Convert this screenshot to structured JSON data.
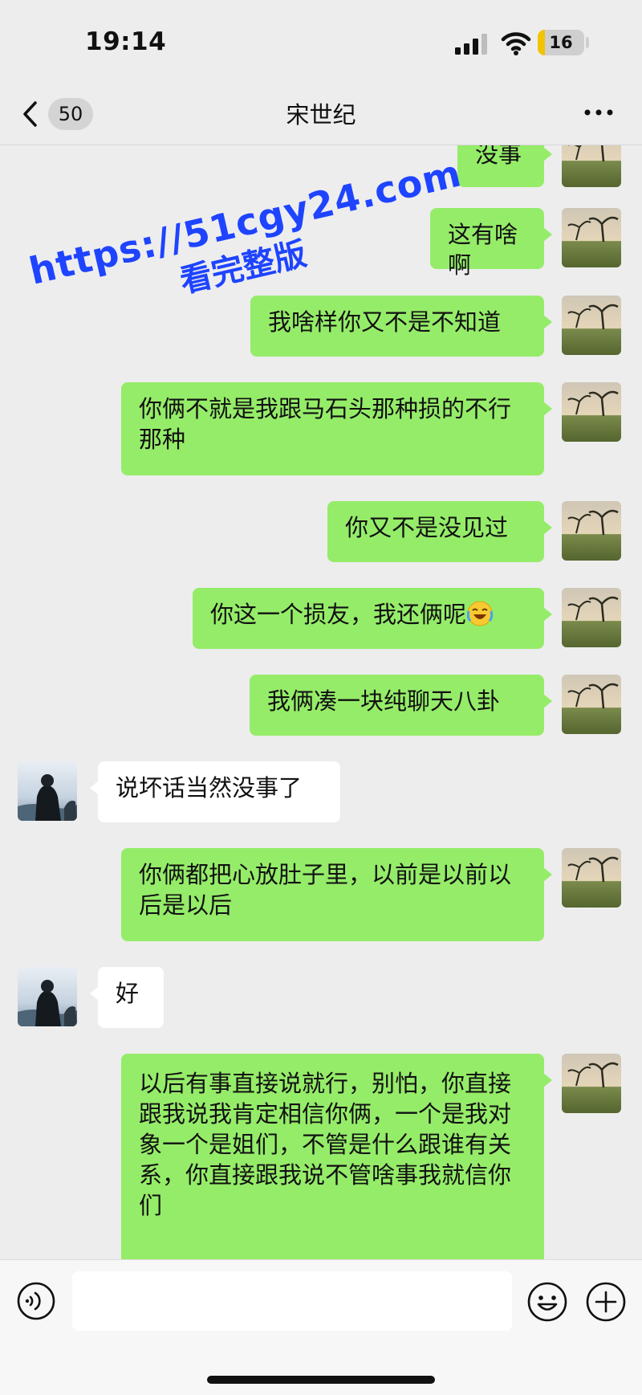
{
  "status": {
    "time": "19:14",
    "battery": "16",
    "battery_level": 0.16
  },
  "nav": {
    "title": "宋世纪",
    "unread_count": "50"
  },
  "messages": [
    {
      "side": "out",
      "text": "没事"
    },
    {
      "side": "out",
      "text": "这有啥啊"
    },
    {
      "side": "out",
      "text": "我啥样你又不是不知道"
    },
    {
      "side": "out",
      "text": "你俩不就是我跟马石头那种损的不行那种"
    },
    {
      "side": "out",
      "text": "你又不是没见过"
    },
    {
      "side": "out",
      "text": "你这一个损友，我还俩呢",
      "emoji": "laughing-crying-emoji"
    },
    {
      "side": "out",
      "text": "我俩凑一块纯聊天八卦"
    },
    {
      "side": "in",
      "text": "说坏话当然没事了"
    },
    {
      "side": "out",
      "text": "你俩都把心放肚子里，以前是以前以后是以后"
    },
    {
      "side": "in",
      "text": "好"
    },
    {
      "side": "out",
      "text": "以后有事直接说就行，别怕，你直接跟我说我肯定相信你俩，一个是我对象一个是姐们，不管是什么跟谁有关系，你直接跟我说不管啥事我就信你们"
    }
  ],
  "watermark": {
    "line1": "https://51cgy24.com",
    "line2": "看完整版"
  },
  "input": {
    "value": "",
    "placeholder": ""
  },
  "colors": {
    "outgoing_bubble": "#95ec69",
    "incoming_bubble": "#ffffff",
    "background": "#ededed",
    "watermark": "#1e44ff"
  },
  "icons": [
    "voice-icon",
    "emoji-icon",
    "plus-icon",
    "back-chevron-icon",
    "more-icon",
    "signal-icon",
    "wifi-icon"
  ]
}
